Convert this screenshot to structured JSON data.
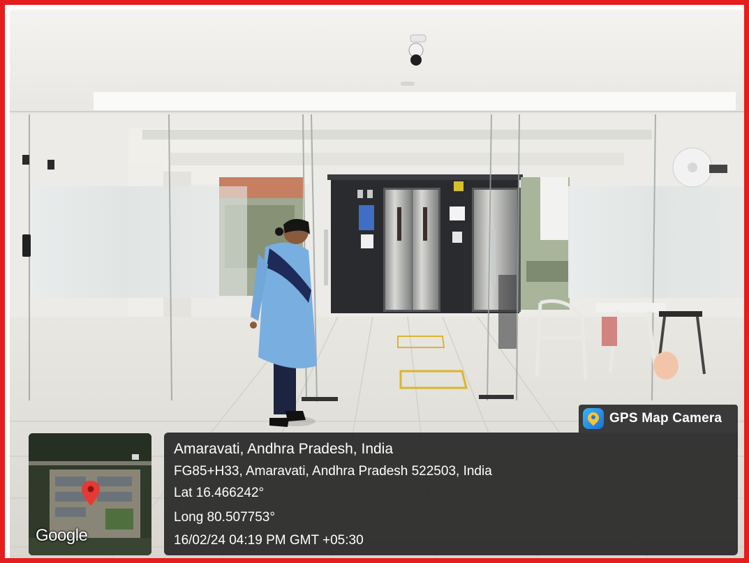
{
  "photo": {
    "border_color": "#e41e1e",
    "colors": {
      "ceiling": "#f3f2ef",
      "floor": "#e4e2dc",
      "lift_lobby": "#2a2b2e",
      "uniform": "#79aee0",
      "trousers": "#1d2440"
    }
  },
  "badge": {
    "icon": "gps-map-camera-icon",
    "label": "GPS Map Camera"
  },
  "location": {
    "place": "Amaravati, Andhra Pradesh, India",
    "address": "FG85+H33, Amaravati, Andhra Pradesh 522503, India",
    "latitude": "Lat 16.466242°",
    "longitude": "Long 80.507753°",
    "datetime": "16/02/24 04:19 PM GMT +05:30"
  },
  "map": {
    "attribution": "Google",
    "marker_icon": "map-pin-icon",
    "marker_color": "#e53935"
  }
}
